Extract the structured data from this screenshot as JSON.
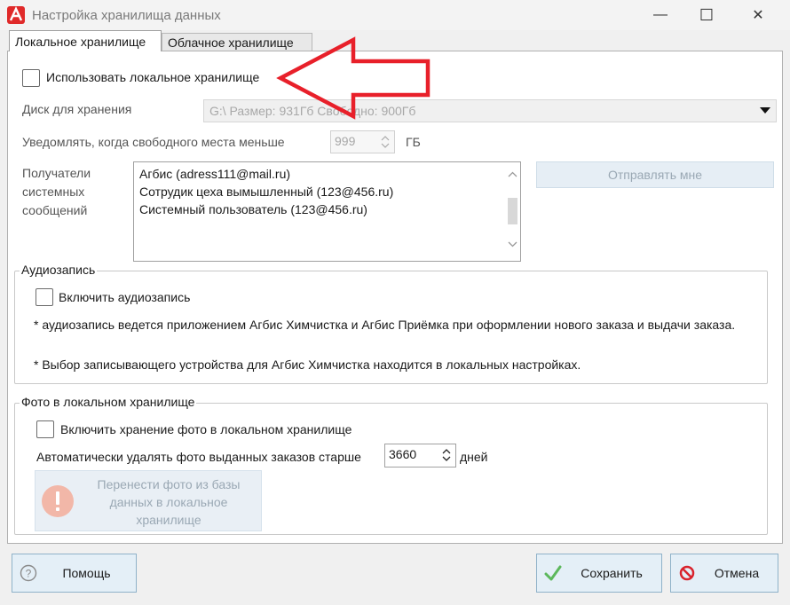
{
  "window": {
    "title": "Настройка хранилища данных",
    "minimize": "—",
    "maximize": "☐",
    "close": "✕"
  },
  "tabs": [
    {
      "label": "Локальное хранилище",
      "active": true
    },
    {
      "label": "Облачное хранилище",
      "active": false
    }
  ],
  "local": {
    "use_local_label": "Использовать локальное хранилище",
    "use_local_checked": false,
    "disk_label": "Диск для хранения",
    "disk_value": "G:\\ Размер: 931Гб Свободно: 900Гб",
    "notify_label": "Уведомлять, когда свободного места меньше",
    "notify_value": "999",
    "notify_unit": "ГБ",
    "recipients_label": "Получатели системных сообщений",
    "recipients": [
      "Агбис (adress111@mail.ru)",
      "Сотрудик цеха вымышленный (123@456.ru)",
      "Системный пользователь (123@456.ru)"
    ],
    "send_me_label": "Отправлять мне"
  },
  "audio": {
    "group_title": "Аудиозапись",
    "enable_label": "Включить аудиозапись",
    "enable_checked": false,
    "note1": "* аудиозапись ведется приложением Агбис Химчистка и Агбис Приёмка при оформлении нового заказа и выдачи заказа.",
    "note2": "* Выбор записывающего устройства для Агбис Химчистка находится в локальных настройках."
  },
  "photo": {
    "group_title": "Фото в локальном хранилище",
    "enable_label": "Включить хранение фото в локальном хранилище",
    "enable_checked": false,
    "auto_delete_label": "Автоматически удалять фото выданных заказов старше",
    "auto_delete_value": "3660",
    "auto_delete_unit": "дней",
    "move_button_label": "Перенести фото из базы данных в локальное хранилище"
  },
  "footer": {
    "help_label": "Помощь",
    "save_label": "Сохранить",
    "cancel_label": "Отмена"
  },
  "colors": {
    "annotation_arrow": "#e8202a",
    "save_check": "#5cb85c",
    "cancel_icon": "#d9232d",
    "button_bg": "#e4eff7",
    "button_border": "#8fb2c9"
  }
}
